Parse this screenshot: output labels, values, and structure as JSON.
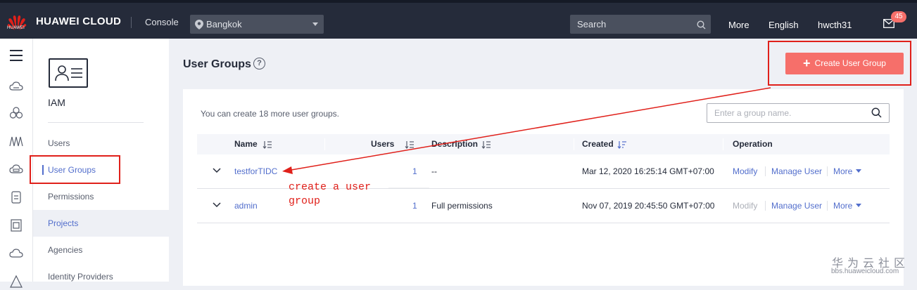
{
  "header": {
    "logo_text": "HUAWEI",
    "brand": "HUAWEI CLOUD",
    "console": "Console",
    "region": "Bangkok",
    "search_placeholder": "Search",
    "more": "More",
    "language": "English",
    "user": "hwcth31",
    "notifications": "45",
    "brand_color": "#e0201a",
    "bar_color": "#252b3a"
  },
  "sidebar": {
    "service_title": "IAM",
    "items": [
      {
        "label": "Users"
      },
      {
        "label": "User Groups"
      },
      {
        "label": "Permissions"
      },
      {
        "label": "Projects"
      },
      {
        "label": "Agencies"
      },
      {
        "label": "Identity Providers"
      }
    ]
  },
  "page": {
    "title": "User Groups",
    "help_icon": "?",
    "create_button": "Create User Group",
    "hint": "You can create 18 more user groups.",
    "search_placeholder": "Enter a group name.",
    "accent_color": "#526ecc",
    "button_color": "#f66f6a"
  },
  "table": {
    "columns": [
      "Name",
      "Users",
      "Description",
      "Created",
      "Operation"
    ],
    "rows": [
      {
        "name": "testforTIDC",
        "users": "1",
        "description": "--",
        "created": "Mar 12, 2020 16:25:14 GMT+07:00",
        "ops": [
          "Modify",
          "Manage User",
          "More"
        ]
      },
      {
        "name": "admin",
        "users": "1",
        "description": "Full permissions",
        "created": "Nov 07, 2019 20:45:50 GMT+07:00",
        "ops": [
          "Modify",
          "Manage User",
          "More"
        ]
      }
    ]
  },
  "annotation": {
    "line1": "create a user",
    "line2": "group",
    "color": "#e0201a"
  },
  "watermark": {
    "cn": "华为云社区",
    "url": "bbs.huaweicloud.com"
  }
}
